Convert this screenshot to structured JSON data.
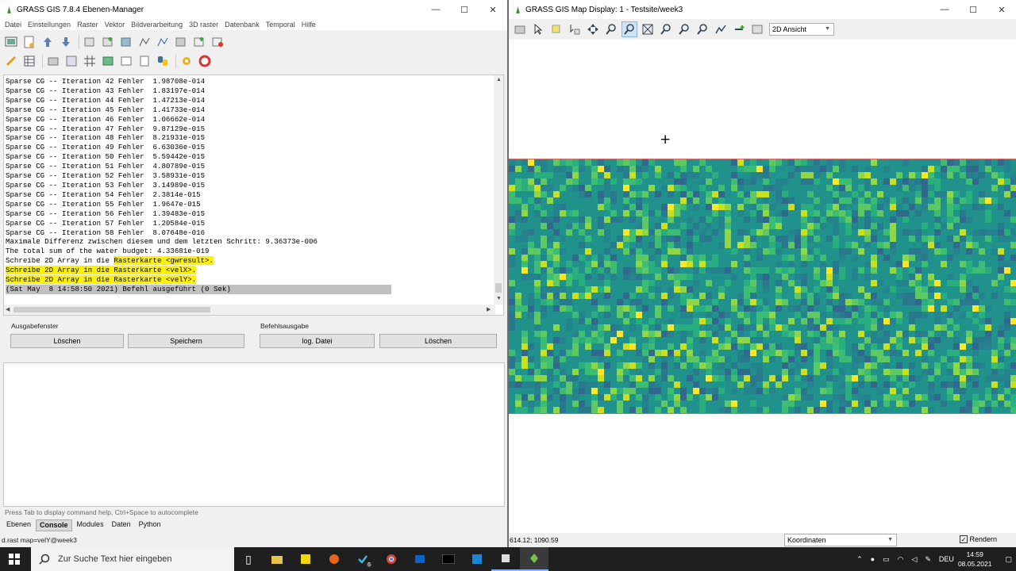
{
  "left_window": {
    "title": "GRASS GIS 7.8.4 Ebenen-Manager",
    "menu": [
      "Datei",
      "Einstellungen",
      "Raster",
      "Vektor",
      "Bildverarbeitung",
      "3D raster",
      "Datenbank",
      "Temporal",
      "Hilfe"
    ],
    "console_lines": [
      {
        "text": "Sparse CG -- Iteration 42 Fehler  1.98708e-014"
      },
      {
        "text": "Sparse CG -- Iteration 43 Fehler  1.83197e-014"
      },
      {
        "text": "Sparse CG -- Iteration 44 Fehler  1.47213e-014"
      },
      {
        "text": "Sparse CG -- Iteration 45 Fehler  1.41733e-014"
      },
      {
        "text": "Sparse CG -- Iteration 46 Fehler  1.06662e-014"
      },
      {
        "text": "Sparse CG -- Iteration 47 Fehler  9.87129e-015"
      },
      {
        "text": "Sparse CG -- Iteration 48 Fehler  8.21931e-015"
      },
      {
        "text": "Sparse CG -- Iteration 49 Fehler  6.63036e-015"
      },
      {
        "text": "Sparse CG -- Iteration 50 Fehler  5.59442e-015"
      },
      {
        "text": "Sparse CG -- Iteration 51 Fehler  4.80789e-015"
      },
      {
        "text": "Sparse CG -- Iteration 52 Fehler  3.58931e-015"
      },
      {
        "text": "Sparse CG -- Iteration 53 Fehler  3.14989e-015"
      },
      {
        "text": "Sparse CG -- Iteration 54 Fehler  2.3814e-015"
      },
      {
        "text": "Sparse CG -- Iteration 55 Fehler  1.9647e-015"
      },
      {
        "text": "Sparse CG -- Iteration 56 Fehler  1.39483e-015"
      },
      {
        "text": "Sparse CG -- Iteration 57 Fehler  1.20584e-015"
      },
      {
        "text": "Sparse CG -- Iteration 58 Fehler  8.07648e-016"
      },
      {
        "text": "Maximale Differenz zwischen diesem und dem letzten Schritt: 9.36373e-006"
      },
      {
        "text": "The total sum of the water budget: 4.33681e-019"
      },
      {
        "text": "Schreibe 2D Array in die ",
        "hl": "Rasterkarte <gwresult>."
      },
      {
        "text": "",
        "hl": "Schreibe 2D Array in die Rasterkarte <velX>."
      },
      {
        "text": "",
        "hl": "Schreibe 2D Array in die Rasterkarte <velY>."
      },
      {
        "text": "",
        "done": "(Sat May  8 14:58:50 2021) Befehl ausgeführt (0 Sek)"
      }
    ],
    "group_output": "Ausgabefenster",
    "group_cmd": "Befehlsausgabe",
    "btn_clear1": "Löschen",
    "btn_save": "Speichern",
    "btn_log": "log. Datei",
    "btn_clear2": "Löschen",
    "hint": "Press Tab to display command help, Ctrl+Space to autocomplete",
    "tabs": [
      "Ebenen",
      "Console",
      "Modules",
      "Daten",
      "Python"
    ],
    "active_tab": "Console",
    "status": "d.rast map=velY@week3"
  },
  "right_window": {
    "title": "GRASS GIS Map Display: 1 - Testsite/week3",
    "view_mode": "2D Ansicht",
    "coords": "614.12; 1090.59",
    "coord_mode": "Koordinaten",
    "render_label": "Rendern",
    "render_checked": true
  },
  "taskbar": {
    "search_placeholder": "Zur Suche Text hier eingeben",
    "badge": "6",
    "lang": "DEU",
    "time": "14:59",
    "date": "08.05.2021"
  },
  "colors": {
    "raster_base": "#21918c",
    "highlight": "#fff200"
  }
}
